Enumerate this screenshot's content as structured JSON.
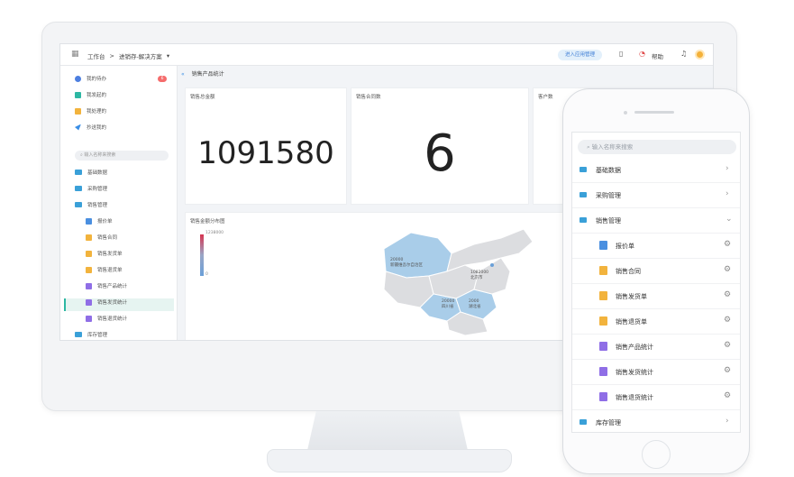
{
  "topbar": {
    "workbench": "工作台",
    "crumb_sep": ">",
    "solution": "进销存-解决方案",
    "dropdown": "▾",
    "enter_app": "进入应用管理",
    "help": "帮助"
  },
  "sidebar": {
    "items_top": [
      "我的待办",
      "我发起的",
      "我处理的",
      "抄送我的"
    ],
    "badge": "6",
    "search_placeholder": "输入名称来搜索",
    "groups": [
      "基础数据",
      "采购管理",
      "销售管理"
    ],
    "sales_children": [
      "报价单",
      "销售合同",
      "销售发货单",
      "销售退货单",
      "销售产品统计",
      "销售发货统计",
      "销售退货统计"
    ],
    "bottom_group": "库存管理"
  },
  "main": {
    "page_title": "销售产品统计",
    "cards": [
      {
        "title": "销售总金额",
        "value": "1091580"
      },
      {
        "title": "销售合同数",
        "value": "6"
      },
      {
        "title": "客户数",
        "value": ""
      }
    ],
    "map_title": "销售金额分布图",
    "legend_max": "1238000",
    "legend_min": "0",
    "map_labels": [
      {
        "value": "20000",
        "place": "新疆维吾尔自治区"
      },
      {
        "value": "1082000",
        "place": "北京市"
      },
      {
        "value": "20000",
        "place": "四川省"
      },
      {
        "value": "2000",
        "place": "湖北省"
      }
    ]
  },
  "phone": {
    "search_placeholder": "输入名称来搜索",
    "groups": [
      "基础数据",
      "采购管理",
      "销售管理"
    ],
    "sales_children": [
      "报价单",
      "销售合同",
      "销售发货单",
      "销售退货单",
      "销售产品统计",
      "销售发货统计",
      "销售退货统计"
    ],
    "bottom_group": "库存管理"
  },
  "colors": {
    "accent": "#2db7a3",
    "folder": "#3aa0d8",
    "badge": "#f56c6c",
    "map_high": "#d6334f",
    "map_low": "#6aa0d8"
  }
}
